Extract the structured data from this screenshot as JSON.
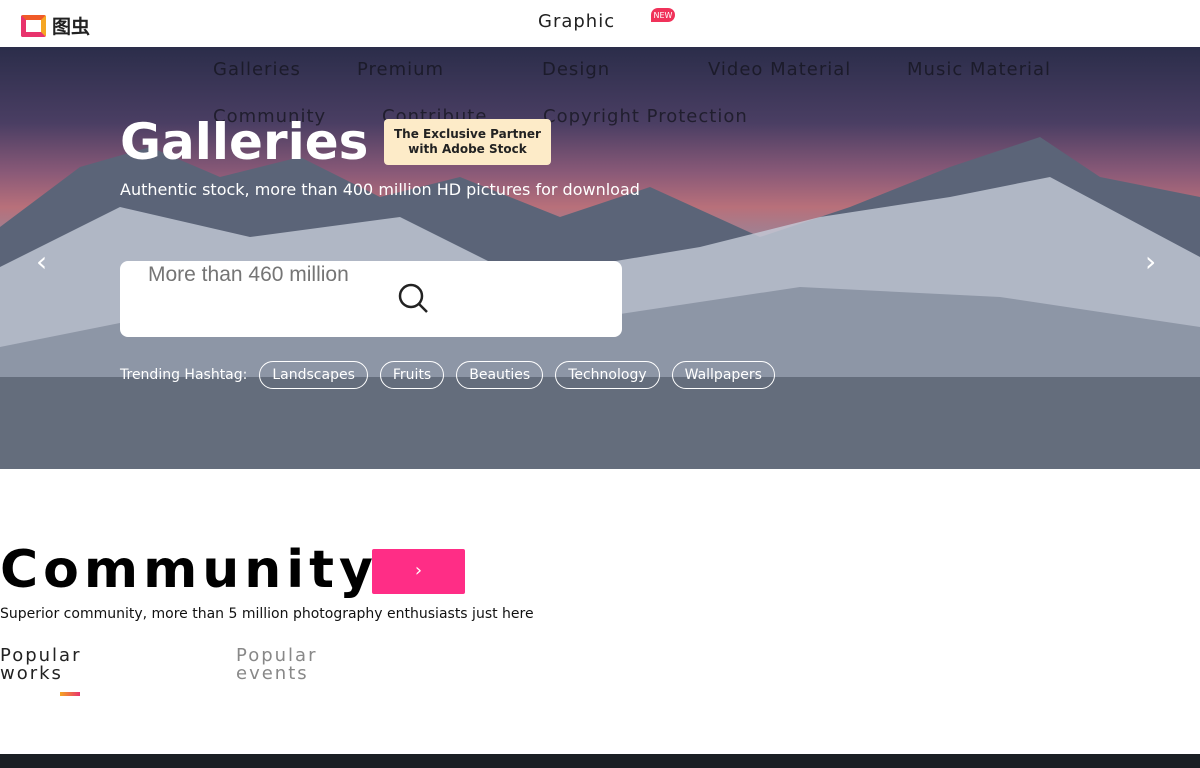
{
  "header": {
    "logo_text": "图虫",
    "graphic": "Graphic",
    "new_badge": "NEW"
  },
  "nav": {
    "items": [
      "Galleries",
      "Premium",
      "Design",
      "Video Material",
      "Music Material",
      "Community",
      "Contribute",
      "Copyright Protection"
    ]
  },
  "hero": {
    "title": "Galleries",
    "partner_line1": "The Exclusive Partner",
    "partner_line2": "with Adobe Stock",
    "subtitle": "Authentic stock, more than 400 million HD pictures for download",
    "search_placeholder": "More than 460 million",
    "trending_label": "Trending Hashtag:",
    "tags": [
      "Landscapes",
      "Fruits",
      "Beauties",
      "Technology",
      "Wallpapers"
    ]
  },
  "community": {
    "title": "Community",
    "subtitle": "Superior community, more than 5 million photography enthusiasts just here",
    "tabs": [
      "Popular works",
      "Popular events"
    ]
  },
  "colors": {
    "accent": "#ff2d86",
    "partner_bg": "#fdebc8",
    "new_badge": "#f0325a"
  }
}
